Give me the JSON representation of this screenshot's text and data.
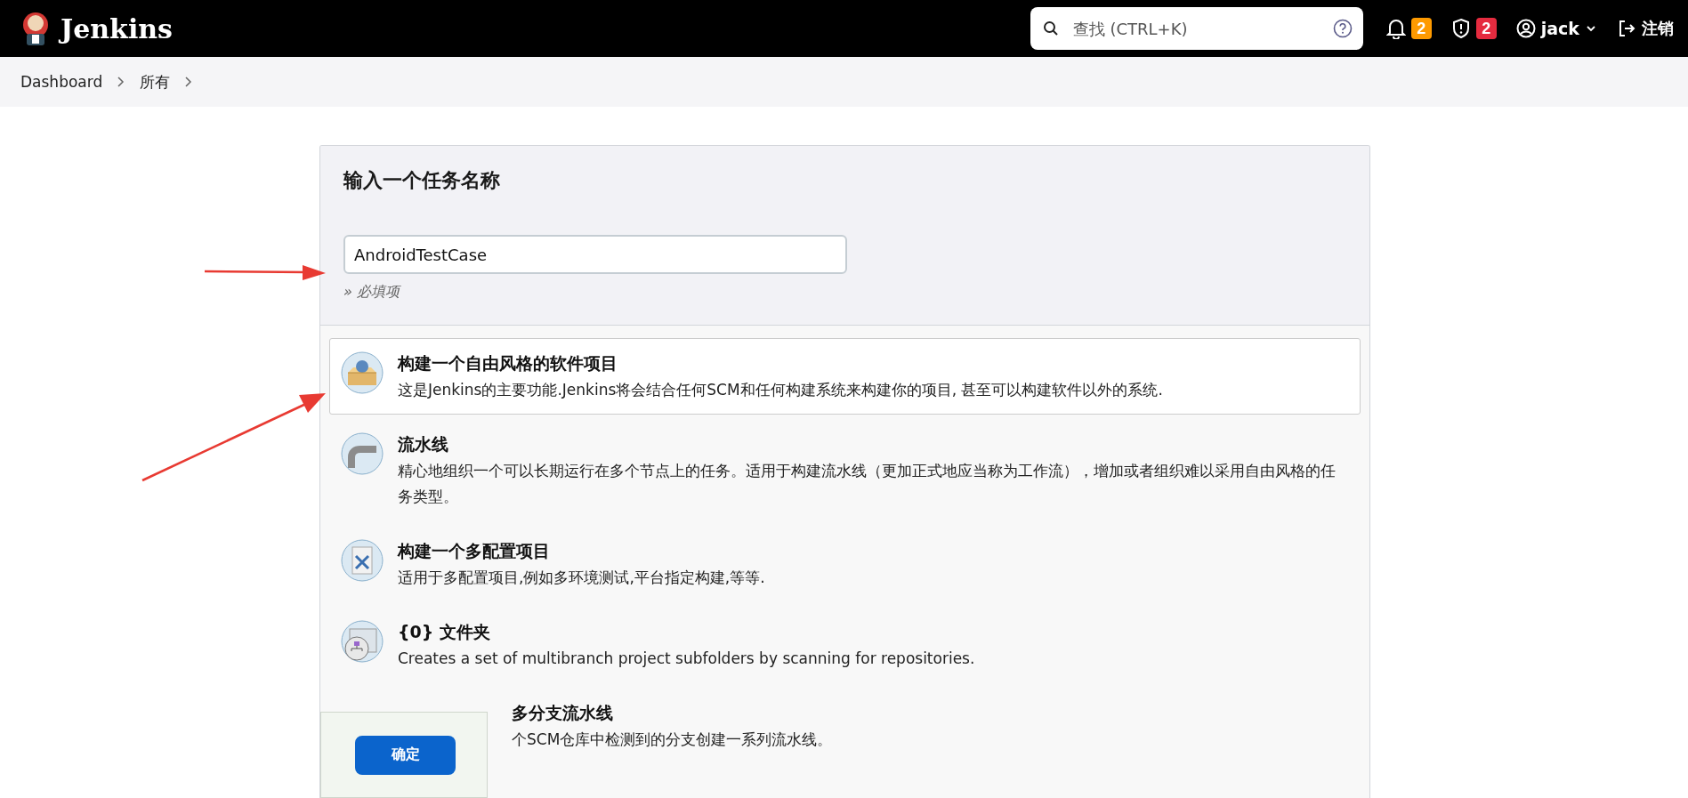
{
  "header": {
    "brand": "Jenkins",
    "search": {
      "placeholder": "查找 (CTRL+K)"
    },
    "badges": [
      {
        "kind": "bell",
        "count": "2",
        "color": "#fe9a00"
      },
      {
        "kind": "shield",
        "count": "2",
        "color": "#e52b3f"
      }
    ],
    "user": "jack",
    "logout": "注销"
  },
  "breadcrumbs": [
    {
      "label": "Dashboard"
    },
    {
      "label": "所有"
    }
  ],
  "form": {
    "title": "输入一个任务名称",
    "name_field": {
      "value": "AndroidTestCase"
    },
    "hint": "» 必填项"
  },
  "item_types": [
    {
      "kind": "box",
      "title": "构建一个自由风格的软件项目",
      "description": "这是Jenkins的主要功能.Jenkins将会结合任何SCM和任何构建系统来构建你的项目, 甚至可以构建软件以外的系统.",
      "selected": true
    },
    {
      "kind": "pipe",
      "title": "流水线",
      "description": "精心地组织一个可以长期运行在多个节点上的任务。适用于构建流水线（更加正式地应当称为工作流），增加或者组织难以采用自由风格的任务类型。",
      "selected": false
    },
    {
      "kind": "tools",
      "title": "构建一个多配置项目",
      "description": "适用于多配置项目,例如多环境测试,平台指定构建,等等.",
      "selected": false
    },
    {
      "kind": "folder",
      "title": "{0} 文件夹",
      "description": "Creates a set of multibranch project subfolders by scanning for repositories.",
      "selected": false
    },
    {
      "kind": "multibranch",
      "title": "多分支流水线",
      "description": "个SCM仓库中检测到的分支创建一系列流水线。",
      "selected": false
    }
  ],
  "submit": {
    "label": "确定"
  }
}
